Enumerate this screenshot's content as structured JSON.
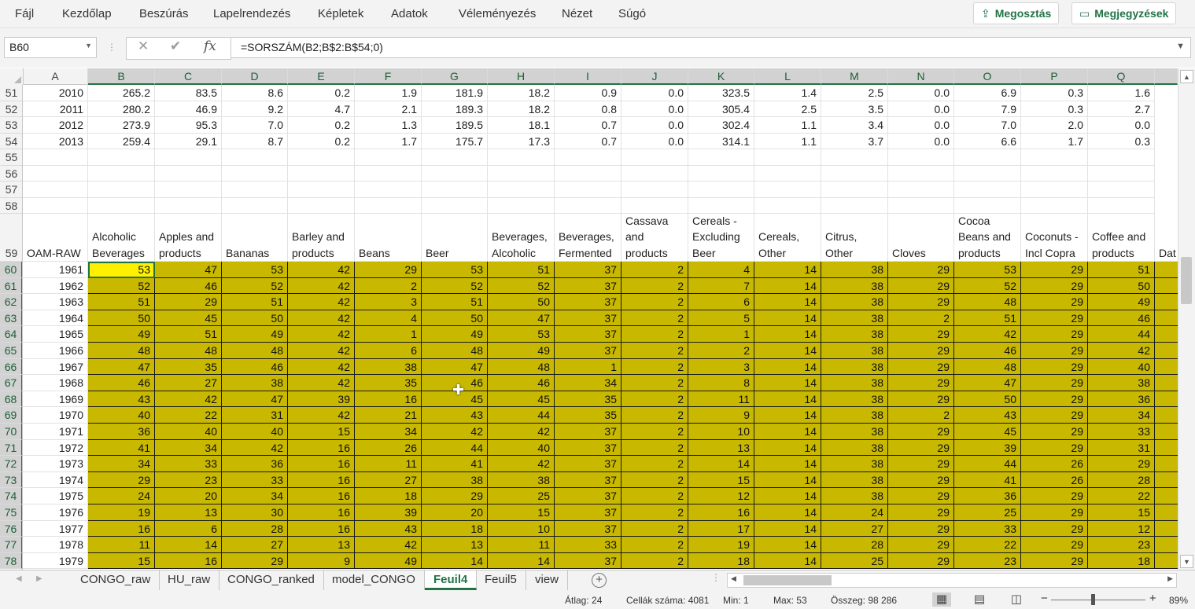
{
  "ribbon": {
    "menu": [
      "Fájl",
      "Kezdőlap",
      "Beszúrás",
      "Lapelrendezés",
      "Képletek",
      "Adatok",
      "Véleményezés",
      "Nézet",
      "Súgó"
    ],
    "share_label": "Megosztás",
    "comments_label": "Megjegyzések"
  },
  "formula_bar": {
    "name_box": "B60",
    "cancel_icon": "✕",
    "enter_icon": "✔",
    "fx_label": "fx",
    "formula": "=SORSZÁM(B2;B$2:B$54;0)"
  },
  "columns": [
    "A",
    "B",
    "C",
    "D",
    "E",
    "F",
    "G",
    "H",
    "I",
    "J",
    "K",
    "L",
    "M",
    "N",
    "O",
    "P",
    "Q"
  ],
  "rows_top": [
    {
      "row": "51",
      "cells": [
        "2010",
        "265.2",
        "83.5",
        "8.6",
        "0.2",
        "1.9",
        "181.9",
        "18.2",
        "0.9",
        "0.0",
        "323.5",
        "1.4",
        "2.5",
        "0.0",
        "6.9",
        "0.3",
        "1.6"
      ]
    },
    {
      "row": "52",
      "cells": [
        "2011",
        "280.2",
        "46.9",
        "9.2",
        "4.7",
        "2.1",
        "189.3",
        "18.2",
        "0.8",
        "0.0",
        "305.4",
        "2.5",
        "3.5",
        "0.0",
        "7.9",
        "0.3",
        "2.7"
      ]
    },
    {
      "row": "53",
      "cells": [
        "2012",
        "273.9",
        "95.3",
        "7.0",
        "0.2",
        "1.3",
        "189.5",
        "18.1",
        "0.7",
        "0.0",
        "302.4",
        "1.1",
        "3.4",
        "0.0",
        "7.0",
        "2.0",
        "0.0"
      ]
    },
    {
      "row": "54",
      "cells": [
        "2013",
        "259.4",
        "29.1",
        "8.7",
        "0.2",
        "1.7",
        "175.7",
        "17.3",
        "0.7",
        "0.0",
        "314.1",
        "1.1",
        "3.7",
        "0.0",
        "6.6",
        "1.7",
        "0.3"
      ]
    }
  ],
  "empty_rows": [
    "55",
    "56",
    "57",
    "58"
  ],
  "header_row": {
    "row": "59",
    "cells": [
      "OAM-RAW",
      "Alcoholic Beverages",
      "Apples and products",
      "Bananas",
      "Barley and products",
      "Beans",
      "Beer",
      "Beverages, Alcoholic",
      "Beverages, Fermented",
      "Cassava and products",
      "Cereals - Excluding Beer",
      "Cereals, Other",
      "Citrus, Other",
      "Cloves",
      "Cocoa Beans and products",
      "Coconuts - Incl Copra",
      "Coffee and products"
    ],
    "overflow_text": "Dat"
  },
  "rank_rows": [
    {
      "row": "60",
      "cells": [
        "1961",
        "53",
        "47",
        "53",
        "42",
        "29",
        "53",
        "51",
        "37",
        "2",
        "4",
        "14",
        "38",
        "29",
        "53",
        "29",
        "51"
      ]
    },
    {
      "row": "61",
      "cells": [
        "1962",
        "52",
        "46",
        "52",
        "42",
        "2",
        "52",
        "52",
        "37",
        "2",
        "7",
        "14",
        "38",
        "29",
        "52",
        "29",
        "50"
      ]
    },
    {
      "row": "62",
      "cells": [
        "1963",
        "51",
        "29",
        "51",
        "42",
        "3",
        "51",
        "50",
        "37",
        "2",
        "6",
        "14",
        "38",
        "29",
        "48",
        "29",
        "49"
      ]
    },
    {
      "row": "63",
      "cells": [
        "1964",
        "50",
        "45",
        "50",
        "42",
        "4",
        "50",
        "47",
        "37",
        "2",
        "5",
        "14",
        "38",
        "2",
        "51",
        "29",
        "46"
      ]
    },
    {
      "row": "64",
      "cells": [
        "1965",
        "49",
        "51",
        "49",
        "42",
        "1",
        "49",
        "53",
        "37",
        "2",
        "1",
        "14",
        "38",
        "29",
        "42",
        "29",
        "44"
      ]
    },
    {
      "row": "65",
      "cells": [
        "1966",
        "48",
        "48",
        "48",
        "42",
        "6",
        "48",
        "49",
        "37",
        "2",
        "2",
        "14",
        "38",
        "29",
        "46",
        "29",
        "42"
      ]
    },
    {
      "row": "66",
      "cells": [
        "1967",
        "47",
        "35",
        "46",
        "42",
        "38",
        "47",
        "48",
        "1",
        "2",
        "3",
        "14",
        "38",
        "29",
        "48",
        "29",
        "40"
      ]
    },
    {
      "row": "67",
      "cells": [
        "1968",
        "46",
        "27",
        "38",
        "42",
        "35",
        "46",
        "46",
        "34",
        "2",
        "8",
        "14",
        "38",
        "29",
        "47",
        "29",
        "38"
      ]
    },
    {
      "row": "68",
      "cells": [
        "1969",
        "43",
        "42",
        "47",
        "39",
        "16",
        "45",
        "45",
        "35",
        "2",
        "11",
        "14",
        "38",
        "29",
        "50",
        "29",
        "36"
      ]
    },
    {
      "row": "69",
      "cells": [
        "1970",
        "40",
        "22",
        "31",
        "42",
        "21",
        "43",
        "44",
        "35",
        "2",
        "9",
        "14",
        "38",
        "2",
        "43",
        "29",
        "34"
      ]
    },
    {
      "row": "70",
      "cells": [
        "1971",
        "36",
        "40",
        "40",
        "15",
        "34",
        "42",
        "42",
        "37",
        "2",
        "10",
        "14",
        "38",
        "29",
        "45",
        "29",
        "33"
      ]
    },
    {
      "row": "71",
      "cells": [
        "1972",
        "41",
        "34",
        "42",
        "16",
        "26",
        "44",
        "40",
        "37",
        "2",
        "13",
        "14",
        "38",
        "29",
        "39",
        "29",
        "31"
      ]
    },
    {
      "row": "72",
      "cells": [
        "1973",
        "34",
        "33",
        "36",
        "16",
        "11",
        "41",
        "42",
        "37",
        "2",
        "14",
        "14",
        "38",
        "29",
        "44",
        "26",
        "29"
      ]
    },
    {
      "row": "73",
      "cells": [
        "1974",
        "29",
        "23",
        "33",
        "16",
        "27",
        "38",
        "38",
        "37",
        "2",
        "15",
        "14",
        "38",
        "29",
        "41",
        "26",
        "28"
      ]
    },
    {
      "row": "74",
      "cells": [
        "1975",
        "24",
        "20",
        "34",
        "16",
        "18",
        "29",
        "25",
        "37",
        "2",
        "12",
        "14",
        "38",
        "29",
        "36",
        "29",
        "22"
      ]
    },
    {
      "row": "75",
      "cells": [
        "1976",
        "19",
        "13",
        "30",
        "16",
        "39",
        "20",
        "15",
        "37",
        "2",
        "16",
        "14",
        "24",
        "29",
        "25",
        "29",
        "15"
      ]
    },
    {
      "row": "76",
      "cells": [
        "1977",
        "16",
        "6",
        "28",
        "16",
        "43",
        "18",
        "10",
        "37",
        "2",
        "17",
        "14",
        "27",
        "29",
        "33",
        "29",
        "12"
      ]
    },
    {
      "row": "77",
      "cells": [
        "1978",
        "11",
        "14",
        "27",
        "13",
        "42",
        "13",
        "11",
        "33",
        "2",
        "19",
        "14",
        "28",
        "29",
        "22",
        "29",
        "23"
      ]
    },
    {
      "row": "78",
      "cells": [
        "1979",
        "15",
        "16",
        "29",
        "9",
        "49",
        "14",
        "14",
        "37",
        "2",
        "18",
        "14",
        "25",
        "29",
        "23",
        "29",
        "18"
      ]
    }
  ],
  "sheet_tabs": [
    "CONGO_raw",
    "HU_raw",
    "CONGO_ranked",
    "model_CONGO",
    "Feuil4",
    "Feuil5",
    "view"
  ],
  "active_sheet": "Feuil4",
  "status": {
    "average": "Átlag:  24",
    "count": "Cellák száma: 4081",
    "min": "Min:  1",
    "max": "Max:  53",
    "sum": "Összeg:  98 286",
    "zoom_minus": "−",
    "zoom_plus": "+",
    "zoom": "89%"
  },
  "colors": {
    "accent": "#217346",
    "selection_fill": "#c8b800",
    "active_cell": "#ffef00"
  }
}
